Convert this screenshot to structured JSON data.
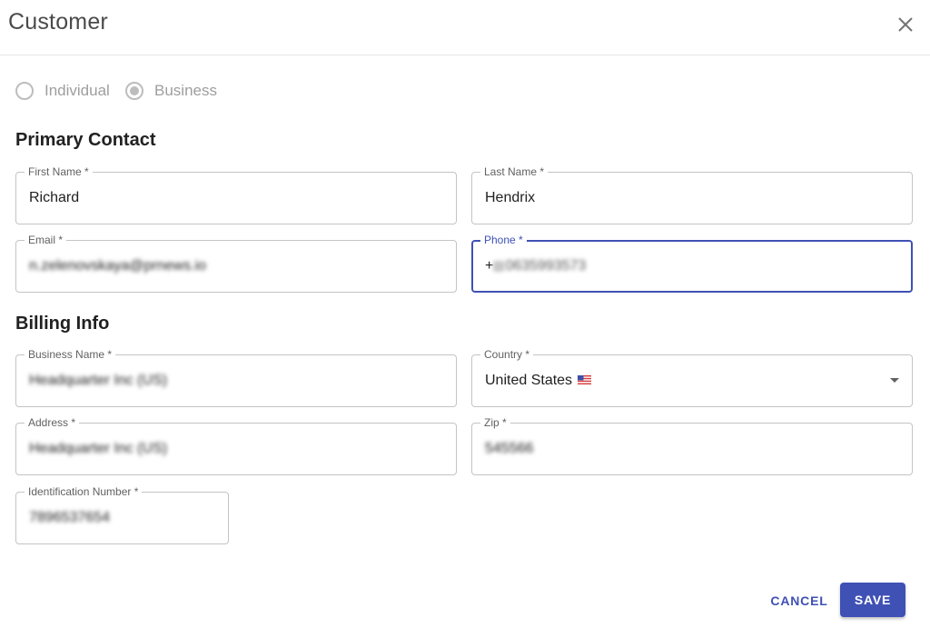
{
  "dialog": {
    "title": "Customer"
  },
  "customer_type": {
    "options": [
      {
        "label": "Individual",
        "selected": false
      },
      {
        "label": "Business",
        "selected": true
      }
    ]
  },
  "primary_contact": {
    "heading": "Primary Contact",
    "first_name": {
      "label": "First Name *",
      "value": "Richard"
    },
    "last_name": {
      "label": "Last Name *",
      "value": "Hendrix"
    },
    "email": {
      "label": "Email *",
      "value": "n.zelenovskaya@prnews.io"
    },
    "phone": {
      "label": "Phone *",
      "prefix": "+",
      "value": "0635993573"
    }
  },
  "billing_info": {
    "heading": "Billing Info",
    "business_name": {
      "label": "Business Name *",
      "value": "Headquarter Inc (US)"
    },
    "country": {
      "label": "Country *",
      "value": "United States"
    },
    "address": {
      "label": "Address *",
      "value": "Headquarter Inc (US)"
    },
    "zip": {
      "label": "Zip *",
      "value": "545566"
    },
    "identification_number": {
      "label": "Identification Number *",
      "value": "7896537654"
    }
  },
  "actions": {
    "cancel_label": "CANCEL",
    "save_label": "SAVE"
  },
  "icons": {
    "close": "close-icon",
    "dropdown": "chevron-down-icon",
    "flag": "us-flag-icon"
  },
  "colors": {
    "accent": "#3f51b5",
    "border": "#c4c4c4",
    "muted": "#9e9e9e"
  }
}
